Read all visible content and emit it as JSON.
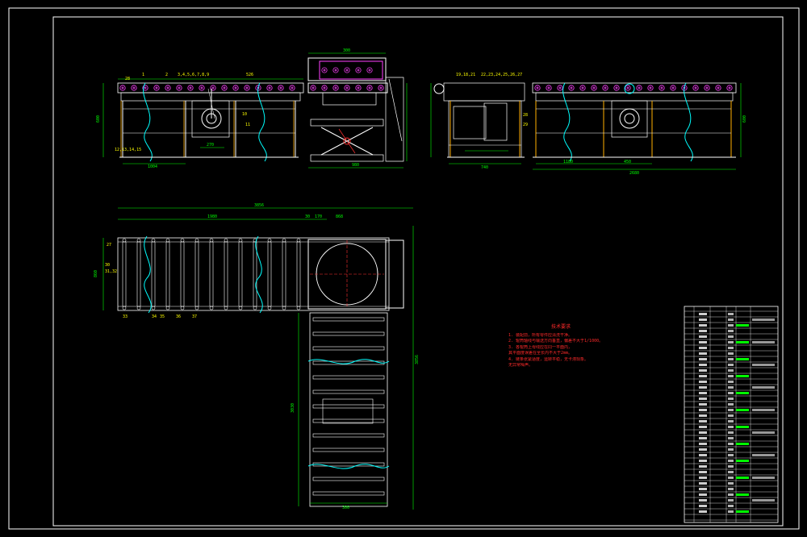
{
  "drawing": {
    "tech_notes_title": "技术要求",
    "tech_notes": [
      "1. 装配前，所有零件应清洗干净。",
      "2. 辊筒轴线与输送方向垂直，偏差不大于1/1000。",
      "3. 各辊筒上母线应在同一平面内，",
      "   其平面度误差在全长内不大于2mm。",
      "4. 链条张紧适度，运转平稳，无卡滞现象。",
      "   无异常噪声。"
    ],
    "dims": {
      "plan_total": "3856",
      "plan_left": "1980",
      "plan_a": "30",
      "plan_b": "170",
      "plan_c": "868",
      "top_300": "300",
      "front_1004": "1004",
      "front_270": "270",
      "lift_980": "980",
      "front_height_left": "600",
      "front_height_right": "600",
      "side_740": "740",
      "right_1180": "1180",
      "right_450": "450",
      "right_total": "2680",
      "vert_3856": "3856",
      "vert_3030": "3030",
      "bottom_300": "300",
      "plan_left_width": "860",
      "plan_small": "27"
    },
    "colors": {
      "frame": "#ffffff",
      "structure": "#ffffff",
      "dimension": "#00ff00",
      "detail": "#ffff00",
      "highlight": "#ff00ff",
      "centerline": "#ff3030",
      "rollers": "#00ffff"
    }
  }
}
